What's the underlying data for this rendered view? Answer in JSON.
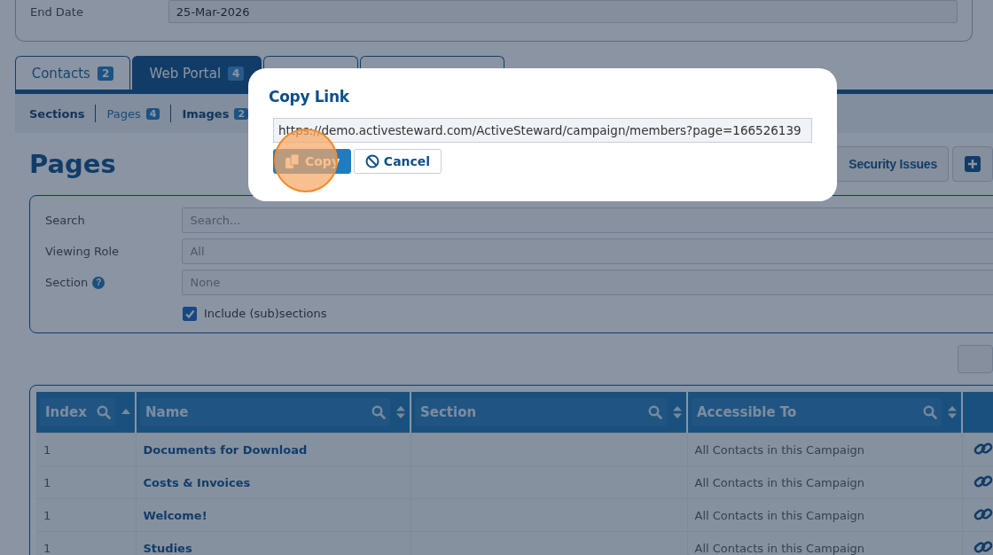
{
  "end_date": {
    "label": "End Date",
    "value": "25-Mar-2026"
  },
  "tabs": [
    {
      "label": "Contacts",
      "count": "2",
      "selected": false
    },
    {
      "label": "Web Portal",
      "count": "4",
      "selected": true
    },
    {
      "selected": false
    },
    {
      "selected": false
    }
  ],
  "subtabs": [
    {
      "label": "Sections",
      "selected": false
    },
    {
      "label": "Pages",
      "count": "4",
      "selected": true
    },
    {
      "label": "Images",
      "count": "2",
      "selected": false
    }
  ],
  "heading": "Pages",
  "actions": [
    {
      "kind": "text",
      "label": "Security Issues"
    },
    {
      "kind": "add"
    }
  ],
  "filters": [
    {
      "label": "Search",
      "placeholder": "Search..."
    },
    {
      "label": "Viewing Role",
      "placeholder": "All"
    },
    {
      "label": "Section",
      "placeholder": "None",
      "help_icon": "?"
    }
  ],
  "include_subsections": {
    "label": "Include (sub)sections",
    "checked": true
  },
  "table": {
    "columns": [
      {
        "label": "Index",
        "sorted": true
      },
      {
        "label": "Name",
        "sorted": false
      },
      {
        "label": "Section",
        "sorted": false
      },
      {
        "label": "Accessible To",
        "sorted": false
      }
    ],
    "rows": [
      {
        "index": "1",
        "name": "Documents for Download",
        "access": "All Contacts in this Campaign"
      },
      {
        "index": "1",
        "name": "Costs & Invoices",
        "access": "All Contacts in this Campaign"
      },
      {
        "index": "1",
        "name": "Welcome!",
        "access": "All Contacts in this Campaign"
      },
      {
        "index": "1",
        "name": "Studies",
        "access": "All Contacts in this Campaign"
      }
    ]
  },
  "dialog": {
    "title": "Copy Link",
    "url": "https://demo.activesteward.com/ActiveSteward/campaign/members?page=166526139",
    "buttons": [
      {
        "kind": "primary",
        "label": "Copy",
        "highlighted": true
      },
      {
        "kind": "secondary",
        "label": "Cancel",
        "highlighted": false
      }
    ]
  }
}
